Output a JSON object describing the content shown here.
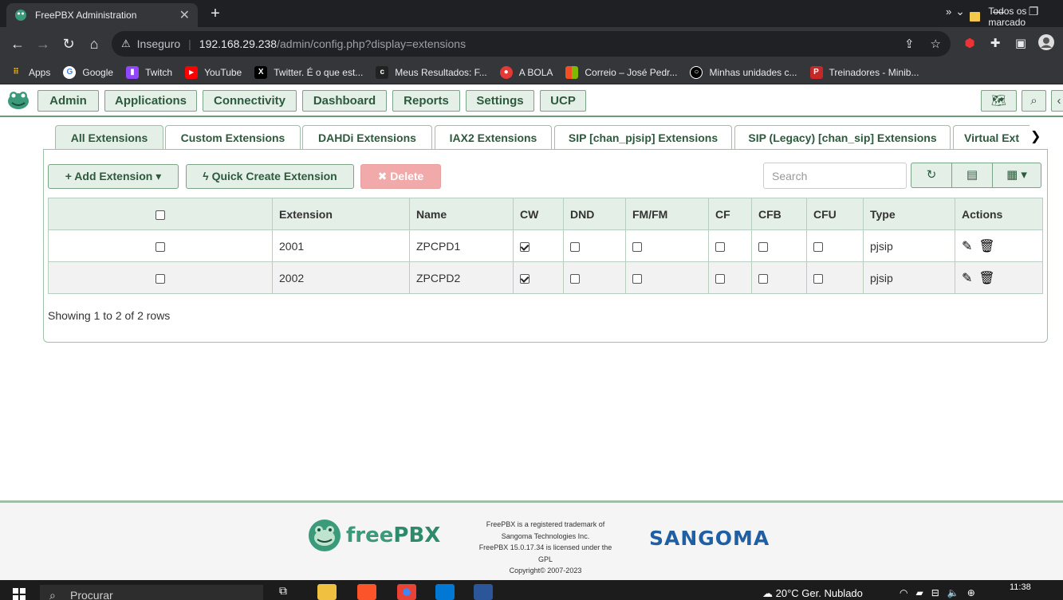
{
  "browser": {
    "tab_title": "FreePBX Administration",
    "tab_close": "✕",
    "new_tab": "+",
    "security_label": "Inseguro",
    "url_host": "192.168.29.238",
    "url_path": "/admin/config.php?display=extensions",
    "bookmarks": [
      {
        "label": "Apps",
        "icon": "apps-grid",
        "color": "#4285f4"
      },
      {
        "label": "Google",
        "icon": "google",
        "color": "#ffffff"
      },
      {
        "label": "Twitch",
        "icon": "twitch",
        "color": "#9146ff"
      },
      {
        "label": "YouTube",
        "icon": "youtube",
        "color": "#ff0000"
      },
      {
        "label": "Twitter. É o que est...",
        "icon": "x-twitter",
        "color": "#000000"
      },
      {
        "label": "Meus Resultados: F...",
        "icon": "results",
        "color": "#222222"
      },
      {
        "label": "A BOLA",
        "icon": "abola",
        "color": "#e53935"
      },
      {
        "label": "Correio – José Pedr...",
        "icon": "microsoft",
        "color": "#f25022"
      },
      {
        "label": "Minhas unidades c...",
        "icon": "github",
        "color": "#000000"
      },
      {
        "label": "Treinadores - Minib...",
        "icon": "p-logo",
        "color": "#c62828"
      }
    ],
    "bookmarks_more": "»",
    "all_bookmarks": "Todos os marcado"
  },
  "pbx_nav": {
    "items": [
      "Admin",
      "Applications",
      "Connectivity",
      "Dashboard",
      "Reports",
      "Settings",
      "UCP"
    ]
  },
  "ext_tabs": [
    "All Extensions",
    "Custom Extensions",
    "DAHDi Extensions",
    "IAX2 Extensions",
    "SIP [chan_pjsip] Extensions",
    "SIP (Legacy) [chan_sip] Extensions",
    "Virtual Ext"
  ],
  "toolbar": {
    "add_label": "+ Add Extension ▾",
    "quick_label": "ϟ Quick Create Extension",
    "delete_label": "✖ Delete",
    "search_placeholder": "Search"
  },
  "table": {
    "headers": [
      "",
      "Extension",
      "Name",
      "CW",
      "DND",
      "FM/FM",
      "CF",
      "CFB",
      "CFU",
      "Type",
      "Actions"
    ],
    "rows": [
      {
        "extension": "2001",
        "name": "ZPCPD1",
        "cw": true,
        "dnd": false,
        "fmfm": false,
        "cf": false,
        "cfb": false,
        "cfu": false,
        "type": "pjsip"
      },
      {
        "extension": "2002",
        "name": "ZPCPD2",
        "cw": true,
        "dnd": false,
        "fmfm": false,
        "cf": false,
        "cfb": false,
        "cfu": false,
        "type": "pjsip"
      }
    ],
    "info": "Showing 1 to 2 of 2 rows"
  },
  "footer": {
    "freepbx_a": "free",
    "freepbx_b": "PBX",
    "legal_1": "FreePBX is a registered trademark of",
    "legal_2": "Sangoma Technologies Inc.",
    "legal_3": "FreePBX 15.0.17.34 is licensed under the",
    "legal_4": "GPL",
    "legal_5": "Copyright© 2007-2023",
    "sangoma": "SANGOMA"
  },
  "taskbar": {
    "search": "Procurar",
    "weather": "20°C  Ger. Nublado",
    "time": "11:38"
  }
}
